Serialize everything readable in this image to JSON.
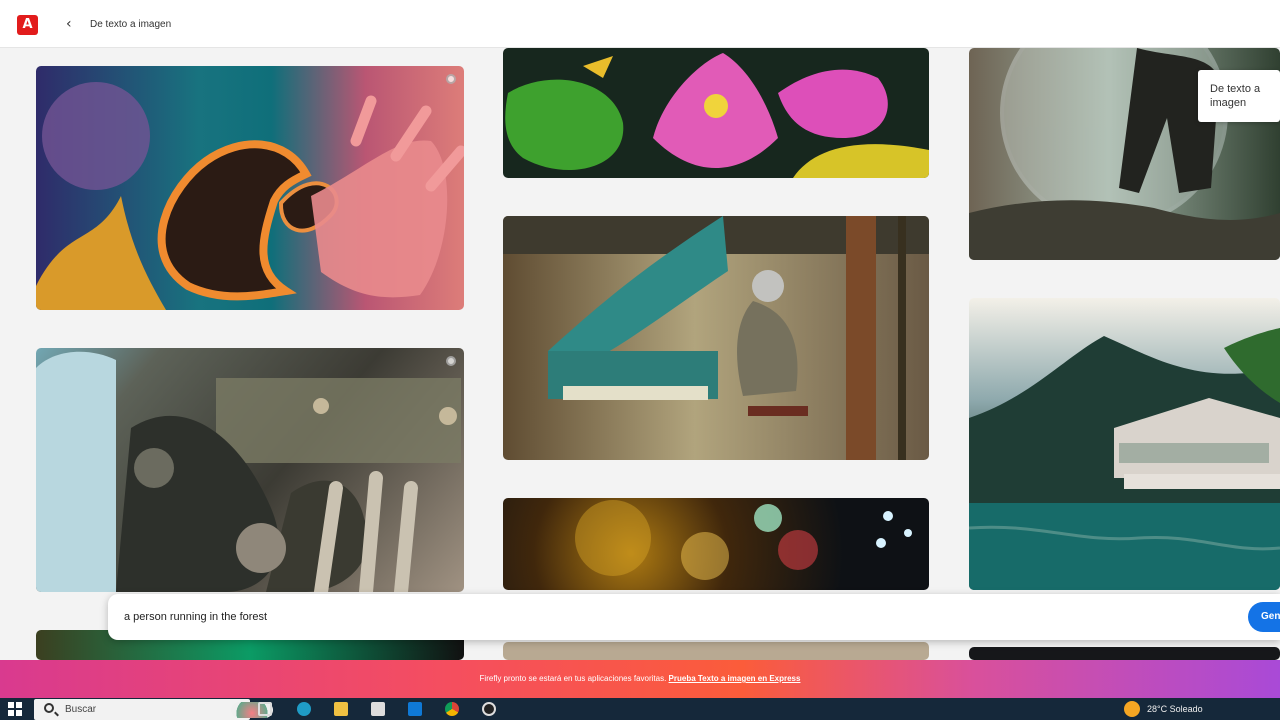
{
  "header": {
    "logo": "A",
    "back_symbol": "‹",
    "title": "De texto a imagen"
  },
  "gallery": {
    "tooltip": "De texto a imagen"
  },
  "prompt": {
    "value": "a person running in the forest",
    "generate_label": "Gen"
  },
  "banner": {
    "text": "Firefly pronto se estará en tus aplicaciones favoritas.",
    "link": "Prueba Texto a imagen en Express"
  },
  "taskbar": {
    "search_placeholder": "Buscar",
    "weather": "28°C  Soleado"
  },
  "colors": {
    "brand": "#e21c1c",
    "generate": "#1473e6",
    "taskbar": "#15283a"
  }
}
